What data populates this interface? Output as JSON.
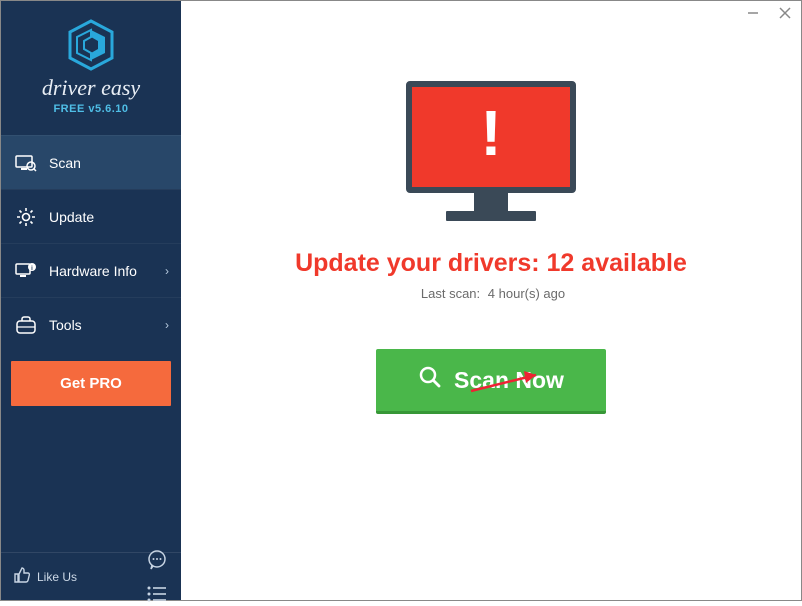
{
  "app": {
    "brand": "driver easy",
    "version": "FREE v5.6.10"
  },
  "sidebar": {
    "items": [
      {
        "label": "Scan"
      },
      {
        "label": "Update"
      },
      {
        "label": "Hardware Info"
      },
      {
        "label": "Tools"
      }
    ],
    "getpro_label": "Get PRO",
    "likeus_label": "Like Us"
  },
  "main": {
    "headline": "Update your drivers: 12 available",
    "lastscan_prefix": "Last scan:",
    "lastscan_value": "4 hour(s) ago",
    "scan_button_label": "Scan Now",
    "alert_icon_glyph": "!"
  },
  "driver_count_available": 12
}
